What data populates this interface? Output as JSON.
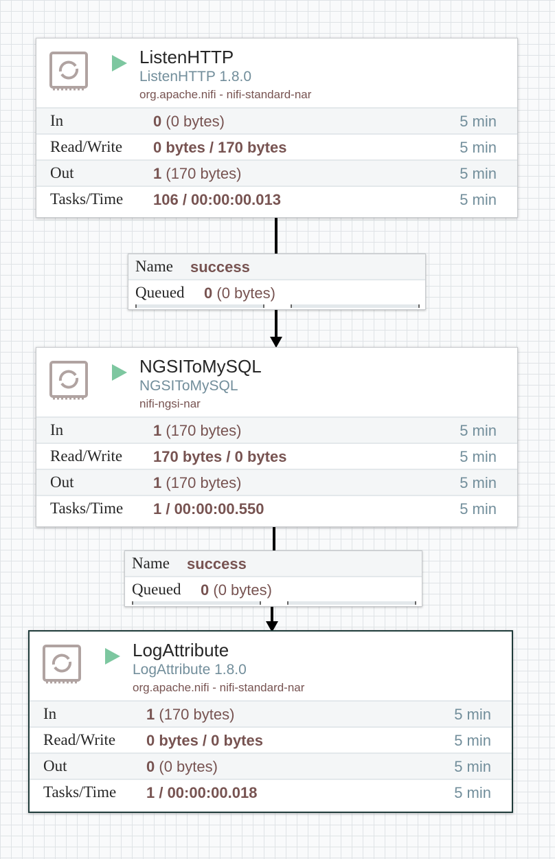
{
  "processors": [
    {
      "name": "ListenHTTP",
      "type": "ListenHTTP 1.8.0",
      "bundle": "org.apache.nifi - nifi-standard-nar",
      "stats": {
        "in_count": "0",
        "in_size": "(0 bytes)",
        "read_write": "0 bytes / 170 bytes",
        "out_count": "1",
        "out_size": "(170 bytes)",
        "tasks_time": "106 / 00:00:00.013"
      }
    },
    {
      "name": "NGSIToMySQL",
      "type": "NGSIToMySQL",
      "bundle": "nifi-ngsi-nar",
      "stats": {
        "in_count": "1",
        "in_size": "(170 bytes)",
        "read_write": "170 bytes / 0 bytes",
        "out_count": "1",
        "out_size": "(170 bytes)",
        "tasks_time": "1 / 00:00:00.550"
      }
    },
    {
      "name": "LogAttribute",
      "type": "LogAttribute 1.8.0",
      "bundle": "org.apache.nifi - nifi-standard-nar",
      "stats": {
        "in_count": "1",
        "in_size": "(170 bytes)",
        "read_write": "0 bytes / 0 bytes",
        "out_count": "0",
        "out_size": "(0 bytes)",
        "tasks_time": "1 / 00:00:00.018"
      }
    }
  ],
  "labels": {
    "in": "In",
    "read_write": "Read/Write",
    "out": "Out",
    "tasks_time": "Tasks/Time",
    "window": "5 min",
    "name": "Name",
    "queued": "Queued"
  },
  "connections": [
    {
      "name": "success",
      "queued_count": "0",
      "queued_size": "(0 bytes)"
    },
    {
      "name": "success",
      "queued_count": "0",
      "queued_size": "(0 bytes)"
    }
  ],
  "colors": {
    "run_icon": "#7dc7a0",
    "type_text": "#728e9b",
    "value_text": "#775351",
    "selected_border": "#1f3b3a"
  },
  "icons": [
    "processor-icon",
    "run-status-icon"
  ]
}
